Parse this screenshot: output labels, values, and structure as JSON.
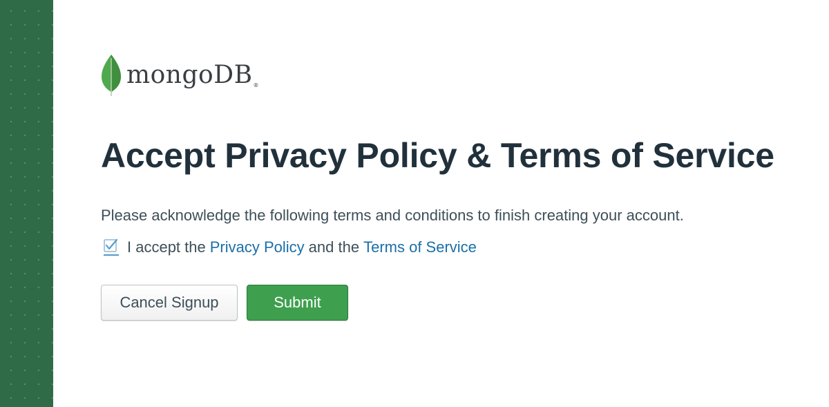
{
  "brand": {
    "wordmark": "mongoDB",
    "registered_mark": "®",
    "leaf_color": "#4fa94d",
    "sidebar_color": "#2f6b47"
  },
  "page": {
    "title": "Accept Privacy Policy & Terms of Service",
    "description": "Please acknowledge the following terms and conditions to finish creating your account."
  },
  "accept": {
    "checked": true,
    "prefix": "I accept the",
    "privacy_link": "Privacy Policy",
    "connector": "and the",
    "terms_link": "Terms of Service",
    "link_color": "#1a6fa8"
  },
  "actions": {
    "cancel_label": "Cancel Signup",
    "submit_label": "Submit",
    "submit_color": "#3e9f4e"
  },
  "icons": {
    "logo": "mongodb-leaf-icon",
    "checkbox": "checkbox-checked-icon"
  }
}
